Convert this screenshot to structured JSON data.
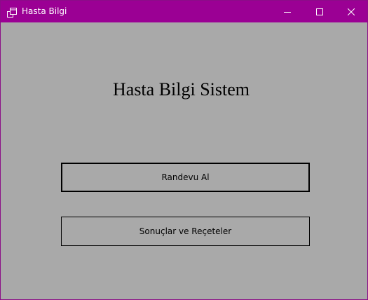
{
  "window": {
    "title": "Hasta Bilgi",
    "app_icon": "app-window-icon",
    "controls": {
      "minimize_icon": "minimize-icon",
      "maximize_icon": "maximize-icon",
      "close_icon": "close-icon"
    },
    "titlebar_color": "#9b0094",
    "background_color": "#a9a9a9"
  },
  "main": {
    "heading": "Hasta Bilgi Sistem",
    "buttons": [
      {
        "label": "Randevu Al"
      },
      {
        "label": "Sonuçlar ve Reçeteler"
      }
    ]
  }
}
